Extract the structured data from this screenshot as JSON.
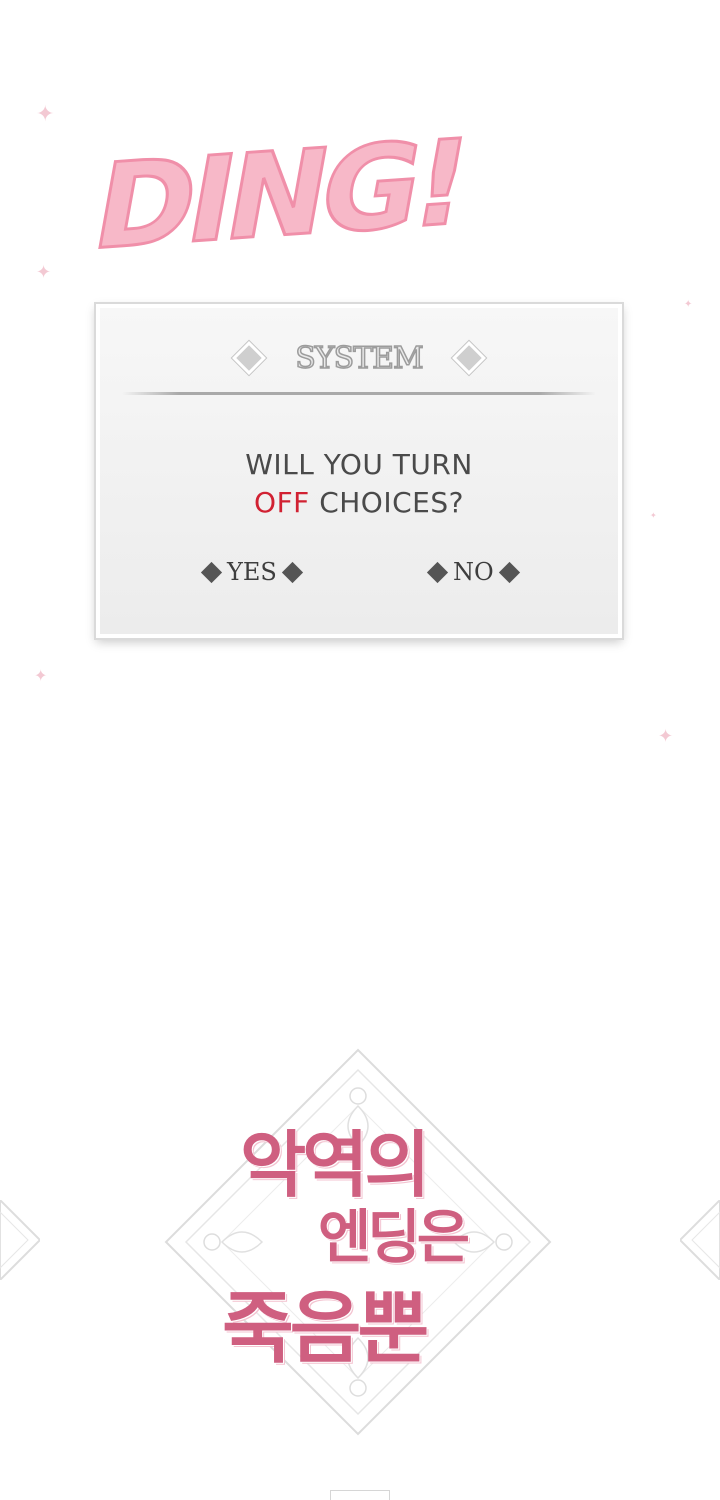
{
  "ding": {
    "text": "DING!"
  },
  "system_dialog": {
    "title": "SYSTEM",
    "question_line1": "WILL YOU TURN",
    "question_highlight": "OFF",
    "question_rest": "CHOICES?",
    "options": [
      {
        "label": "YES"
      },
      {
        "label": "NO"
      }
    ]
  },
  "logo": {
    "line1": "악역의",
    "line2": "엔딩은",
    "line3": "죽음뿐"
  },
  "colors": {
    "ding_pink": "#f7b8c8",
    "highlight_red": "#d12132",
    "logo_pink": "#cf5f80"
  }
}
